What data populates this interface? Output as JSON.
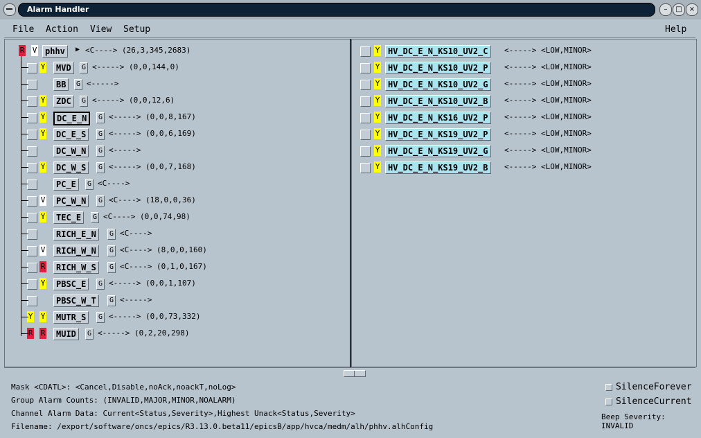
{
  "window": {
    "title": "Alarm Handler"
  },
  "menu": {
    "file": "File",
    "action": "Action",
    "view": "View",
    "setup": "Setup",
    "help": "Help"
  },
  "root": {
    "status1": "R",
    "status2": "V",
    "name": "phhv",
    "summary": "<C----> (26,3,345,2683)"
  },
  "groups": [
    {
      "s1": "",
      "s2": "Y",
      "name": "MVD",
      "g": "G",
      "summary": "<-----> (0,0,144,0)"
    },
    {
      "s1": "",
      "s2": "",
      "name": "BB",
      "g": "G",
      "summary": "<----->"
    },
    {
      "s1": "",
      "s2": "Y",
      "name": "ZDC",
      "g": "G",
      "summary": "<-----> (0,0,12,6)"
    },
    {
      "s1": "",
      "s2": "Y",
      "name": "DC_E_N",
      "g": "G",
      "summary": "<-----> (0,0,8,167)"
    },
    {
      "s1": "",
      "s2": "Y",
      "name": "DC_E_S",
      "g": "G",
      "summary": "<-----> (0,0,6,169)"
    },
    {
      "s1": "",
      "s2": "",
      "name": "DC_W_N",
      "g": "G",
      "summary": "<----->"
    },
    {
      "s1": "",
      "s2": "Y",
      "name": "DC_W_S",
      "g": "G",
      "summary": "<-----> (0,0,7,168)"
    },
    {
      "s1": "",
      "s2": "",
      "name": "PC_E",
      "g": "G",
      "summary": "<C---->"
    },
    {
      "s1": "",
      "s2": "V",
      "name": "PC_W_N",
      "g": "G",
      "summary": "<C----> (18,0,0,36)"
    },
    {
      "s1": "",
      "s2": "Y",
      "name": "TEC_E",
      "g": "G",
      "summary": "<C----> (0,0,74,98)"
    },
    {
      "s1": "",
      "s2": "",
      "name": "RICH_E_N",
      "g": "G",
      "summary": "<C---->"
    },
    {
      "s1": "",
      "s2": "V",
      "name": "RICH_W_N",
      "g": "G",
      "summary": "<C----> (8,0,0,160)"
    },
    {
      "s1": "",
      "s2": "R",
      "name": "RICH_W_S",
      "g": "G",
      "summary": "<C----> (0,1,0,167)"
    },
    {
      "s1": "",
      "s2": "Y",
      "name": "PBSC_E",
      "g": "G",
      "summary": "<-----> (0,0,1,107)"
    },
    {
      "s1": "",
      "s2": "",
      "name": "PBSC_W_T",
      "g": "G",
      "summary": "<----->"
    },
    {
      "s1": "Y",
      "s2": "Y",
      "name": "MUTR_S",
      "g": "G",
      "summary": "<-----> (0,0,73,332)"
    },
    {
      "s1": "R",
      "s2": "R",
      "name": "MUID",
      "g": "G",
      "summary": "<-----> (0,2,20,298)"
    }
  ],
  "channels": [
    {
      "s": "Y",
      "name": "HV_DC_E_N_KS10_UV2_C",
      "summary": "<-----> <LOW,MINOR>"
    },
    {
      "s": "Y",
      "name": "HV_DC_E_N_KS10_UV2_P",
      "summary": "<-----> <LOW,MINOR>"
    },
    {
      "s": "Y",
      "name": "HV_DC_E_N_KS10_UV2_G",
      "summary": "<-----> <LOW,MINOR>"
    },
    {
      "s": "Y",
      "name": "HV_DC_E_N_KS10_UV2_B",
      "summary": "<-----> <LOW,MINOR>"
    },
    {
      "s": "Y",
      "name": "HV_DC_E_N_KS16_UV2_P",
      "summary": "<-----> <LOW,MINOR>"
    },
    {
      "s": "Y",
      "name": "HV_DC_E_N_KS19_UV2_P",
      "summary": "<-----> <LOW,MINOR>"
    },
    {
      "s": "Y",
      "name": "HV_DC_E_N_KS19_UV2_G",
      "summary": "<-----> <LOW,MINOR>"
    },
    {
      "s": "Y",
      "name": "HV_DC_E_N_KS19_UV2_B",
      "summary": "<-----> <LOW,MINOR>"
    }
  ],
  "footer": {
    "mask": "Mask <CDATL>: <Cancel,Disable,noAck,noackT,noLog>",
    "group_counts": "Group Alarm Counts: (INVALID,MAJOR,MINOR,NOALARM)",
    "channel_data": "Channel Alarm Data: Current<Status,Severity>,Highest Unack<Status,Severity>",
    "filename": "Filename: /export/software/oncs/epics/R3.13.0.beta11/epicsB/app/hvca/medm/alh/phhv.alhConfig",
    "silence_forever": "SilenceForever",
    "silence_current": "SilenceCurrent",
    "beep_severity": "Beep Severity: INVALID"
  },
  "colors": {
    "minor": "#ffff00",
    "major": "#e0203d",
    "selected_channel": "#abe4ef",
    "background": "#b7c3cd"
  }
}
